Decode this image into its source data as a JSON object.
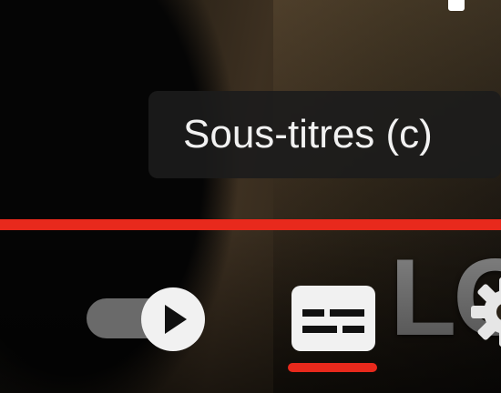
{
  "player": {
    "tooltip": "Sous-titres (c)",
    "progress_ratio": 1.0,
    "autoplay": {
      "state": "on",
      "icon": "play-icon"
    },
    "subtitles": {
      "active": true,
      "icon": "closed-captions-icon"
    },
    "settings": {
      "icon": "gear-icon"
    },
    "background_text": "LO"
  },
  "colors": {
    "accent": "#e8291c",
    "tooltip_bg": "#1c1c1c",
    "tooltip_text": "#f1f1f1",
    "icon_white": "#f1f1f1",
    "toggle_track": "#6a6a6a"
  }
}
